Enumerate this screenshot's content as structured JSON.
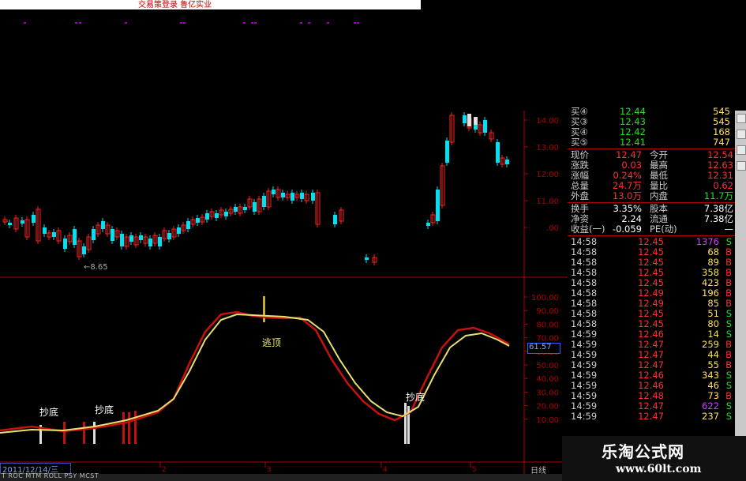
{
  "header": {
    "title": "交易策登录 鲁亿实业"
  },
  "price_axis": {
    "ticks": [
      "14.00",
      "13.00",
      "12.00",
      "11.00",
      ".00"
    ]
  },
  "low_marker": "←8.65",
  "indicator_axis": {
    "ticks": [
      "100.00",
      "90.00",
      "80.00",
      "70.00",
      "60.00",
      "50.00",
      "40.00",
      "30.00",
      "20.00",
      "10.00"
    ]
  },
  "current_indicator_value": "61.57",
  "signals": {
    "top_label": "逃顶",
    "bottom_label": "抄底"
  },
  "date_axis": {
    "selected_date": "2011/12/14/三",
    "ticks": [
      "2",
      "3",
      "4",
      "5"
    ],
    "period": "日线"
  },
  "bottom_tabs": "T  ROC  MTM  ROLL  PSY  MCST",
  "quote": {
    "bids": [
      {
        "label": "买④",
        "price": "12.44",
        "vol": "545"
      },
      {
        "label": "买③",
        "price": "12.43",
        "vol": "545"
      },
      {
        "label": "买④",
        "price": "12.42",
        "vol": "168"
      },
      {
        "label": "买⑤",
        "price": "12.41",
        "vol": "747"
      }
    ],
    "stats": [
      {
        "k1": "现价",
        "v1": "12.47",
        "k2": "今开",
        "v2": "12.54"
      },
      {
        "k1": "涨跌",
        "v1": "0.03",
        "k2": "最高",
        "v2": "12.63"
      },
      {
        "k1": "涨幅",
        "v1": "0.24%",
        "k2": "最低",
        "v2": "12.31"
      },
      {
        "k1": "总量",
        "v1": "24.7万",
        "k2": "量比",
        "v2": "0.62"
      },
      {
        "k1": "外盘",
        "v1": "13.0万",
        "k2": "内盘",
        "v2": "11.7万"
      }
    ],
    "fundamentals": [
      {
        "k1": "换手",
        "v1": "3.35%",
        "k2": "股本",
        "v2": "7.38亿"
      },
      {
        "k1": "净资",
        "v1": "2.24",
        "k2": "流通",
        "v2": "7.38亿"
      },
      {
        "k1": "收益(一)",
        "v1": "-0.059",
        "k2": "PE(动)",
        "v2": "—"
      }
    ],
    "ticks": [
      {
        "time": "14:58",
        "price": "12.45",
        "vol": "1376",
        "side": "S"
      },
      {
        "time": "14:58",
        "price": "12.45",
        "vol": "68",
        "side": "B"
      },
      {
        "time": "14:58",
        "price": "12.45",
        "vol": "89",
        "side": "B"
      },
      {
        "time": "14:58",
        "price": "12.45",
        "vol": "358",
        "side": "B"
      },
      {
        "time": "14:58",
        "price": "12.45",
        "vol": "423",
        "side": "B"
      },
      {
        "time": "14:58",
        "price": "12.49",
        "vol": "196",
        "side": "B"
      },
      {
        "time": "14:58",
        "price": "12.49",
        "vol": "85",
        "side": "B"
      },
      {
        "time": "14:58",
        "price": "12.45",
        "vol": "51",
        "side": "S"
      },
      {
        "time": "14:58",
        "price": "12.45",
        "vol": "80",
        "side": "S"
      },
      {
        "time": "14:59",
        "price": "12.46",
        "vol": "14",
        "side": "S"
      },
      {
        "time": "14:59",
        "price": "12.47",
        "vol": "259",
        "side": "B"
      },
      {
        "time": "14:59",
        "price": "12.47",
        "vol": "44",
        "side": "B"
      },
      {
        "time": "14:59",
        "price": "12.47",
        "vol": "55",
        "side": "B"
      },
      {
        "time": "14:59",
        "price": "12.46",
        "vol": "343",
        "side": "S"
      },
      {
        "time": "14:59",
        "price": "12.46",
        "vol": "46",
        "side": "S"
      },
      {
        "time": "14:59",
        "price": "12.48",
        "vol": "73",
        "side": "B"
      },
      {
        "time": "14:59",
        "price": "12.47",
        "vol": "622",
        "side": "S"
      },
      {
        "time": "14:59",
        "price": "12.47",
        "vol": "237",
        "side": "S"
      }
    ]
  },
  "watermark": {
    "name": "乐淘公式网",
    "url": "www.60lt.com"
  },
  "colors": {
    "up": "#ff2020",
    "down": "#00e0f0",
    "k_line": "#e8e070",
    "d_line": "#c81010"
  }
}
